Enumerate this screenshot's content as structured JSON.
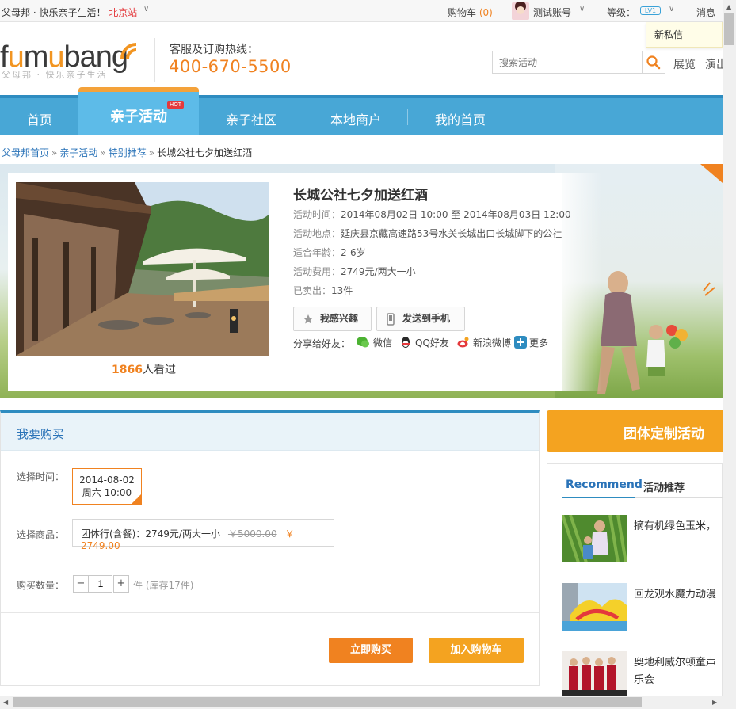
{
  "topbar": {
    "slogan": "父母邦 · 快乐亲子生活！",
    "city": "北京站",
    "cart_label": "购物车",
    "cart_count": "(0)",
    "account": "测试账号",
    "level_label": "等级：",
    "level_badge": "LV1",
    "messages": "消息",
    "new_message": "新私信"
  },
  "header": {
    "logo_text_a": "f",
    "logo_text_u1": "u",
    "logo_text_m": "m",
    "logo_text_u2": "u",
    "logo_text_b": "bang",
    "logo_sub": "父母邦 · 快乐亲子生活",
    "hotline_label": "客服及订购热线：",
    "hotline": "400-670-5500",
    "search_placeholder": "搜索活动",
    "link1": "展览",
    "link2": "演出"
  },
  "nav": {
    "items": [
      "首页",
      "亲子活动",
      "亲子社区",
      "本地商户",
      "我的首页"
    ],
    "hot_badge": "HOT"
  },
  "breadcrumb": [
    "父母邦首页",
    "亲子活动",
    "特别推荐",
    "长城公社七夕加送红酒"
  ],
  "event": {
    "title": "长城公社七夕加送红酒",
    "time_label": "活动时间：",
    "time": "2014年08月02日 10:00 至 2014年08月03日 12:00",
    "place_label": "活动地点：",
    "place": "延庆县京藏高速路53号水关长城出口长城脚下的公社",
    "age_label": "适合年龄：",
    "age": "2-6岁",
    "fee_label": "活动费用：",
    "fee": "2749元/两大一小",
    "sold_label": "已卖出：",
    "sold": "13件",
    "interest_btn": "我感兴趣",
    "phone_btn": "发送到手机",
    "share_label": "分享给好友：",
    "share_wechat": "微信",
    "share_qq": "QQ好友",
    "share_weibo": "新浪微博",
    "share_more": "更多",
    "views_count": "1866",
    "views_suffix": "人看过"
  },
  "buy": {
    "title": "我要购买",
    "time_label": "选择时间：",
    "date": "2014-08-02",
    "weekday_time": "周六 10:00",
    "goods_label": "选择商品：",
    "goods_name": "团体行(含餐)：2749元/两大一小",
    "goods_old_price": "￥5000.00",
    "goods_price": "￥ 2749.00",
    "qty_label": "购买数量：",
    "qty_minus": "−",
    "qty_value": "1",
    "qty_plus": "+",
    "stock": "件 (库存17件)",
    "buy_now": "立即购买",
    "add_cart": "加入购物车"
  },
  "sidebar": {
    "team_btn": "团体定制活动",
    "tab_en": "Recommend",
    "tab_cn": "活动推荐",
    "items": [
      {
        "line1": "摘有机绿色玉米，"
      },
      {
        "line1": "回龙观水魔力动漫"
      },
      {
        "line1": "奥地利威尔顿童声",
        "line2": "乐会"
      }
    ]
  },
  "colors": {
    "accent_orange": "#f08220",
    "nav_blue": "#48a7d6",
    "link_blue": "#2a73b8"
  }
}
